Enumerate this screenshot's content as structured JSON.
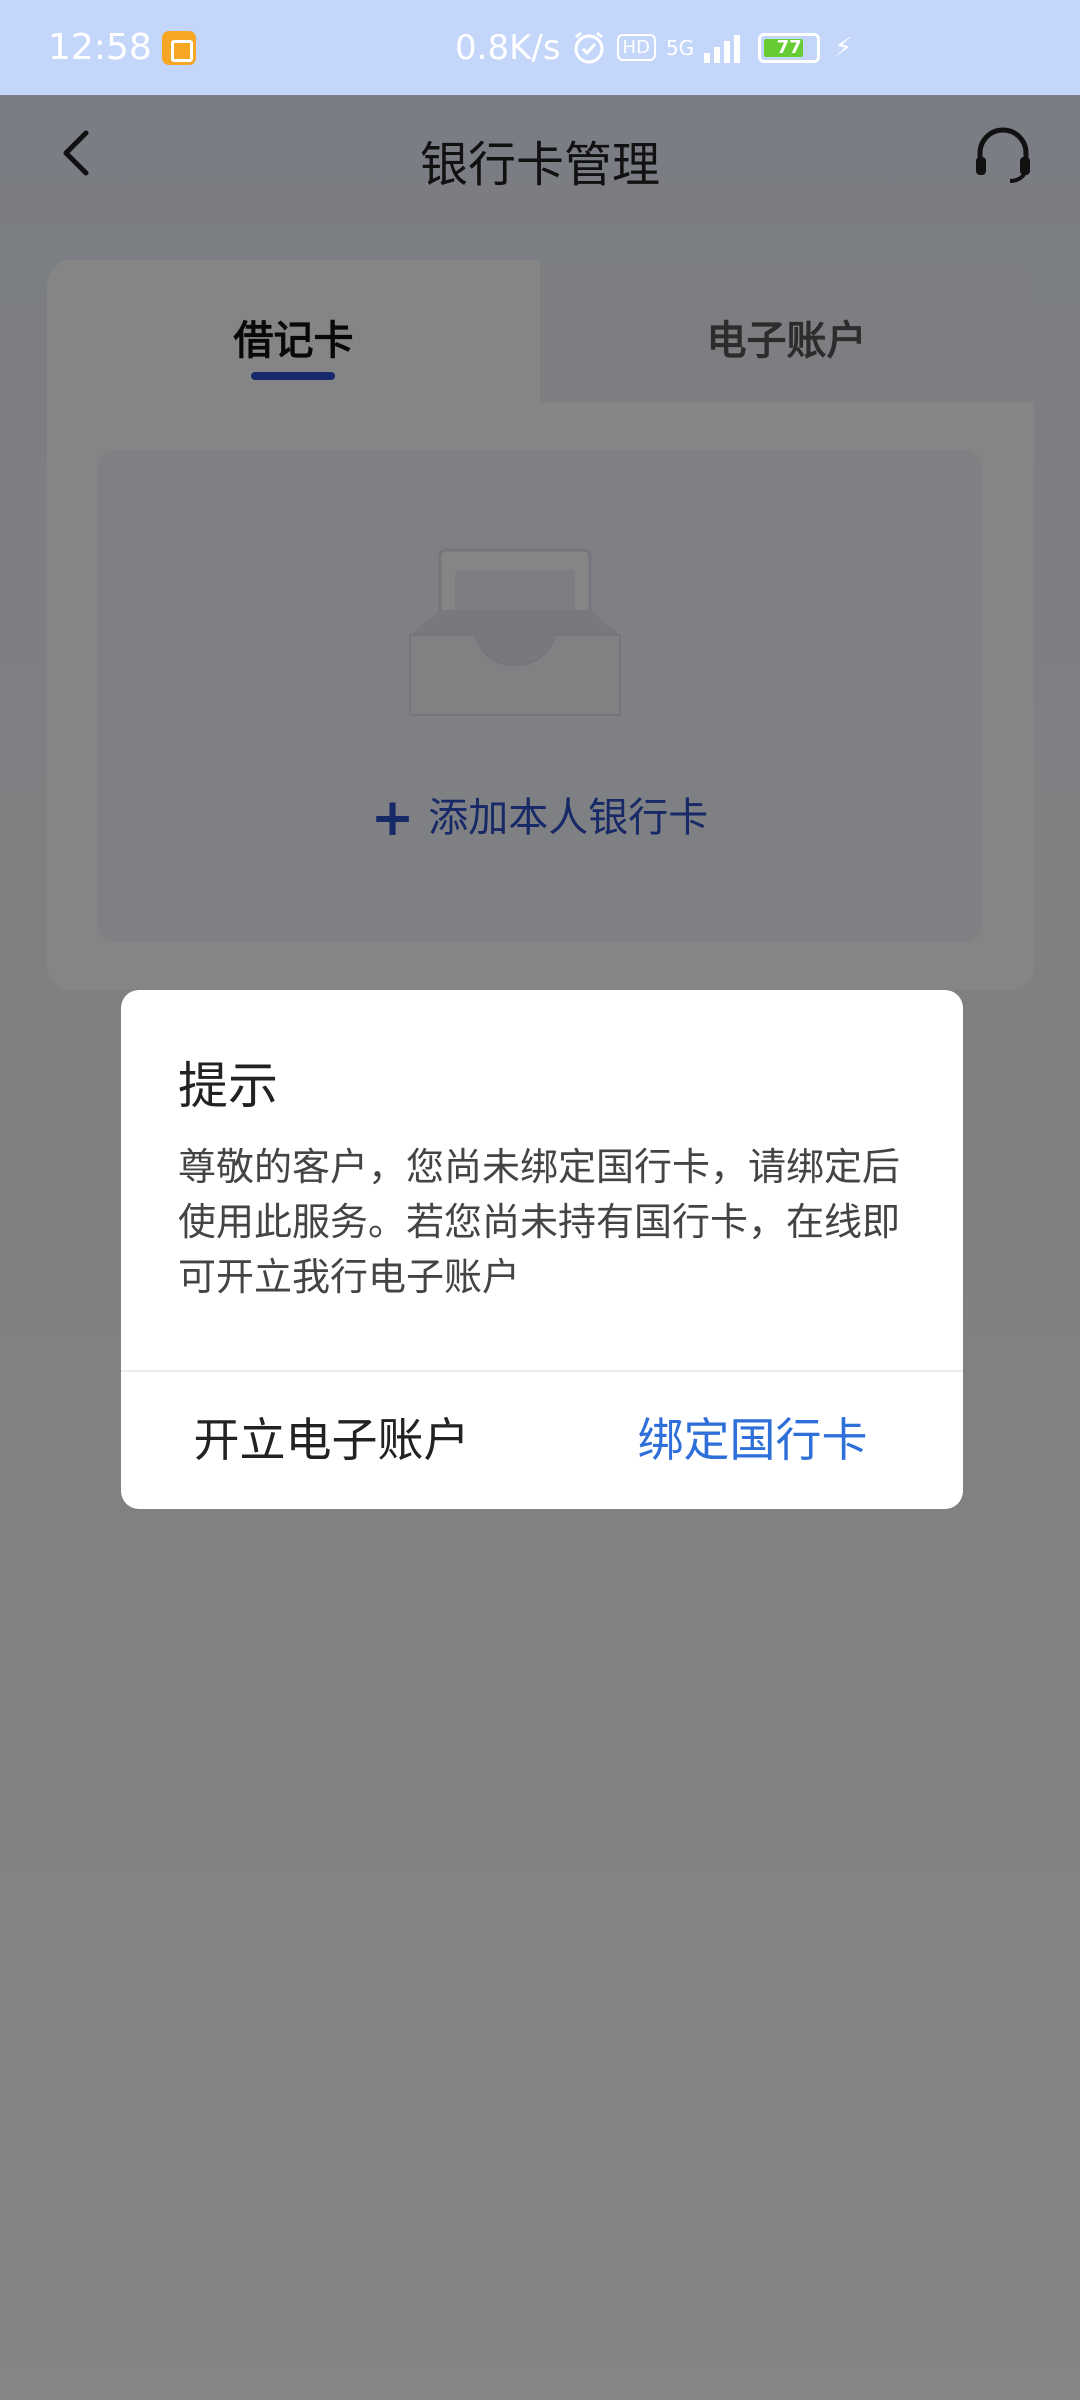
{
  "status_bar": {
    "time": "12:58",
    "net_speed": "0.8K/s",
    "network": "5G",
    "hd_label": "HD",
    "battery_level": "77",
    "battery_fraction": 0.77
  },
  "header": {
    "title": "银行卡管理",
    "back_icon": "chevron-left-icon",
    "service_icon": "headset-icon"
  },
  "tabs": [
    {
      "label": "借记卡",
      "active": true
    },
    {
      "label": "电子账户",
      "active": false
    }
  ],
  "add_card": {
    "label": "添加本人银行卡",
    "icon": "plus-icon"
  },
  "dialog": {
    "title": "提示",
    "message": "尊敬的客户，您尚未绑定国行卡，请绑定后使用此服务。若您尚未持有国行卡，在线即可开立我行电子账户",
    "secondary_button": "开立电子账户",
    "primary_button": "绑定国行卡"
  },
  "colors": {
    "accent": "#2d4ed0",
    "primary_button": "#2f6fd9",
    "battery": "#66cc33"
  }
}
